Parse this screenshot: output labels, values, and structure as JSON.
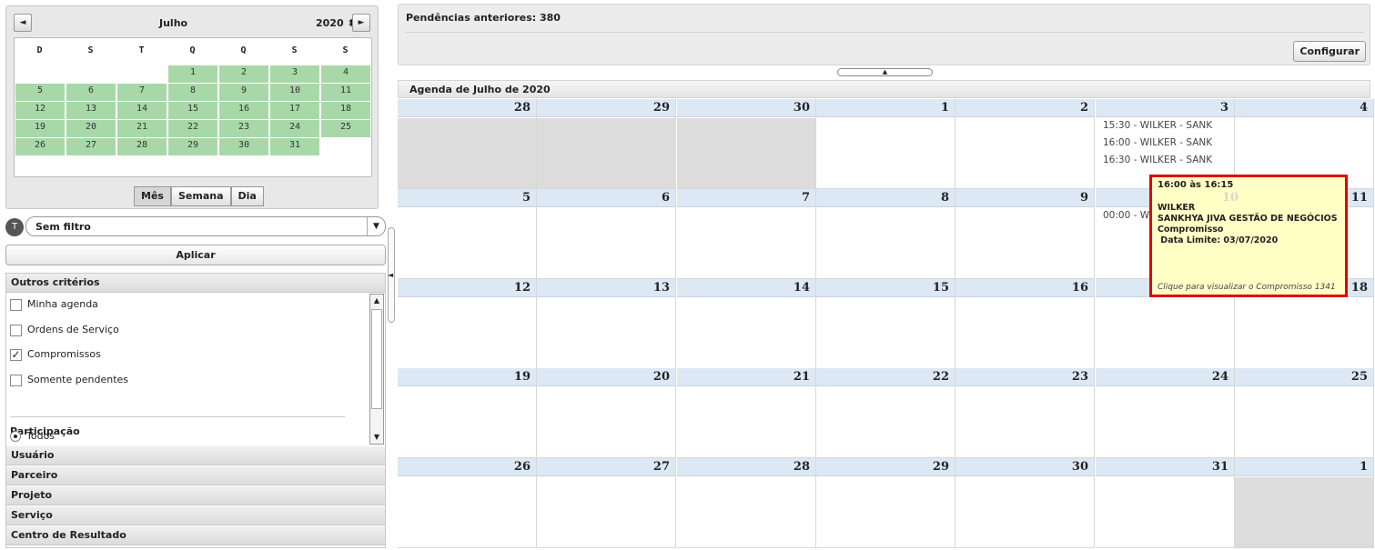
{
  "mini_calendar": {
    "month": "Julho",
    "year": "2020 ⬍",
    "prev_icon": "◄",
    "next_icon": "►",
    "weekdays": [
      "D",
      "S",
      "T",
      "Q",
      "Q",
      "S",
      "S"
    ],
    "weeks": [
      [
        "",
        "",
        "",
        "1",
        "2",
        "3",
        "4"
      ],
      [
        "5",
        "6",
        "7",
        "8",
        "9",
        "10",
        "11"
      ],
      [
        "12",
        "13",
        "14",
        "15",
        "16",
        "17",
        "18"
      ],
      [
        "19",
        "20",
        "21",
        "22",
        "23",
        "24",
        "25"
      ],
      [
        "26",
        "27",
        "28",
        "29",
        "30",
        "31",
        ""
      ]
    ],
    "highlight_color": "#a8d8a8"
  },
  "view_buttons": {
    "month": "Mês",
    "week": "Semana",
    "day": "Dia",
    "active": "month"
  },
  "filter": {
    "icon": "T",
    "selected": "Sem filtro",
    "arrow": "▼"
  },
  "apply_label": "Aplicar",
  "criteria": {
    "header": "Outros critérios",
    "items": [
      {
        "label": "Minha agenda",
        "checked": false
      },
      {
        "label": "Ordens de Serviço",
        "checked": false
      },
      {
        "label": "Compromissos",
        "checked": true
      },
      {
        "label": "Somente pendentes",
        "checked": false
      }
    ],
    "participation_label": "Participação",
    "participation_option": "Todos"
  },
  "accordion": [
    "Usuário",
    "Parceiro",
    "Projeto",
    "Serviço",
    "Centro de Resultado"
  ],
  "pending": {
    "label": "Pendências anteriores: 380",
    "config_label": "Configurar"
  },
  "calendar": {
    "title": "Agenda de Julho de 2020",
    "weeks": [
      [
        "28",
        "29",
        "30",
        "1",
        "2",
        "3",
        "4"
      ],
      [
        "5",
        "6",
        "7",
        "8",
        "9",
        "10",
        "11"
      ],
      [
        "12",
        "13",
        "14",
        "15",
        "16",
        "17",
        "18"
      ],
      [
        "19",
        "20",
        "21",
        "22",
        "23",
        "24",
        "25"
      ],
      [
        "26",
        "27",
        "28",
        "29",
        "30",
        "31",
        "1"
      ]
    ],
    "outside_month": [
      [
        0,
        0
      ],
      [
        0,
        1
      ],
      [
        0,
        2
      ],
      [
        4,
        6
      ]
    ],
    "events": [
      {
        "week": 0,
        "day": 5,
        "text": "15:30 - WILKER - SANK"
      },
      {
        "week": 0,
        "day": 5,
        "text": "16:00 - WILKER - SANK"
      },
      {
        "week": 0,
        "day": 5,
        "text": "16:30 - WILKER - SANK"
      },
      {
        "week": 1,
        "day": 5,
        "text": "00:00 - W"
      }
    ]
  },
  "tooltip": {
    "time": "16:00 às 16:15",
    "ghost_day": "10",
    "lines": [
      "WILKER",
      "SANKHYA JIVA GESTÃO DE NEGÓCIOS",
      "Compromisso",
      " Data Limite: 03/07/2020"
    ],
    "link": "Clique para visualizar o Compromisso 1341",
    "border_color": "#e00000"
  }
}
